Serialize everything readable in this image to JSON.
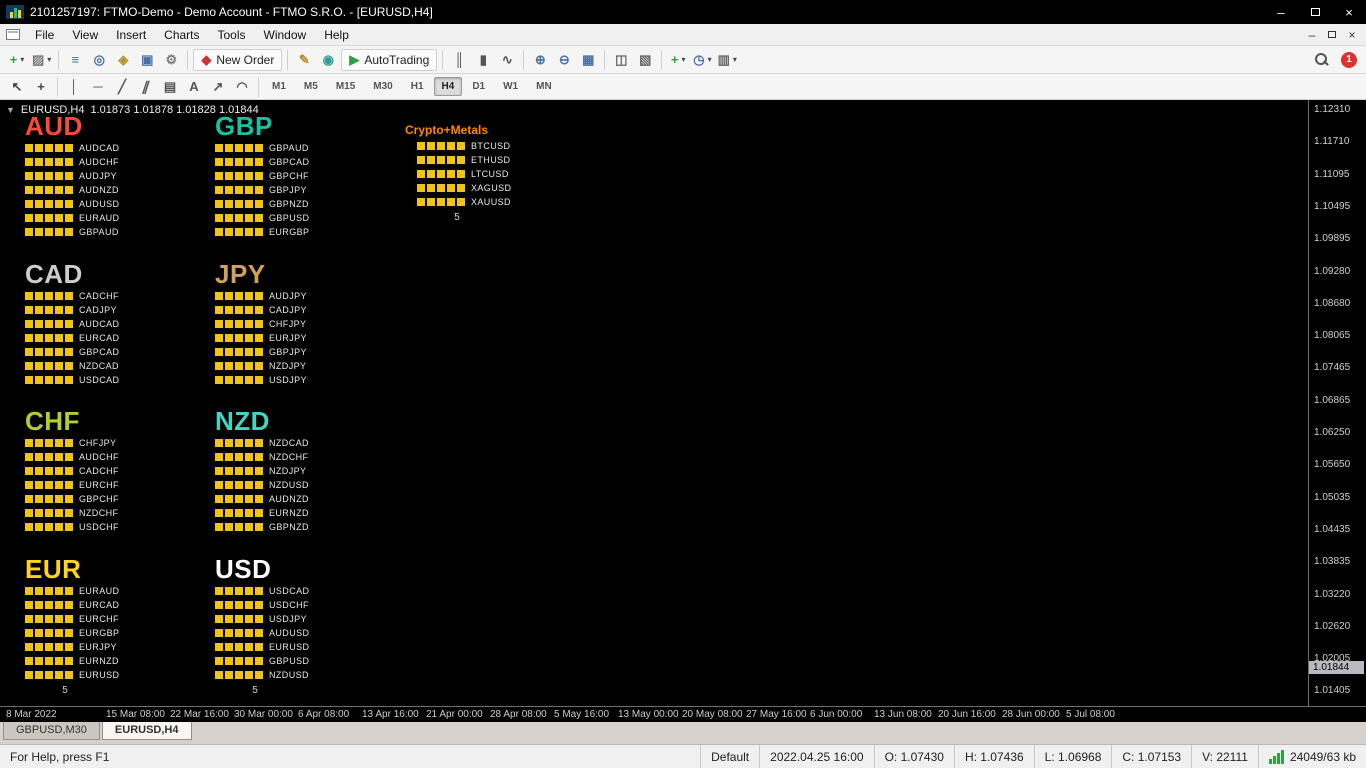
{
  "window": {
    "title": "2101257197: FTMO-Demo - Demo Account - FTMO S.R.O. - [EURUSD,H4]",
    "minimize_glyph": "–",
    "close_glyph": "×"
  },
  "menu": {
    "items": [
      "File",
      "View",
      "Insert",
      "Charts",
      "Tools",
      "Window",
      "Help"
    ]
  },
  "toolbar": {
    "main": [
      {
        "name": "new-chart-button",
        "glyph": "+",
        "color": "#2f9e44",
        "dropdown": true
      },
      {
        "name": "profiles-button",
        "glyph": "▨",
        "color": "#7a7a7a",
        "dropdown": true,
        "sep_after": true
      },
      {
        "name": "market-watch-button",
        "glyph": "≡",
        "color": "#4a6fa5"
      },
      {
        "name": "data-window-button",
        "glyph": "◎",
        "color": "#4a6fa5"
      },
      {
        "name": "navigator-button",
        "glyph": "◈",
        "color": "#b8902a"
      },
      {
        "name": "terminal-button",
        "glyph": "▣",
        "color": "#4a6fa5"
      },
      {
        "name": "strategy-tester-button",
        "glyph": "⚙",
        "color": "#7a7a7a",
        "sep_after": true
      },
      {
        "name": "new-order-button",
        "glyph": "◆",
        "color": "#cc3333",
        "label": "New Order",
        "labeled": true,
        "sep_after": true
      },
      {
        "name": "metaeditor-button",
        "glyph": "✎",
        "color": "#b8902a"
      },
      {
        "name": "mql5-button",
        "glyph": "◉",
        "color": "#2a9d8f"
      },
      {
        "name": "autotrading-button",
        "glyph": "▶",
        "color": "#2f9e44",
        "label": "AutoTrading",
        "labeled": true,
        "sep_after": true
      },
      {
        "name": "chart-bars-button",
        "glyph": "║",
        "color": "#555555"
      },
      {
        "name": "chart-candles-button",
        "glyph": "▮",
        "color": "#555555"
      },
      {
        "name": "chart-line-button",
        "glyph": "∿",
        "color": "#555555",
        "sep_after": true
      },
      {
        "name": "zoom-in-button",
        "glyph": "⊕",
        "color": "#4a6fa5"
      },
      {
        "name": "zoom-out-button",
        "glyph": "⊖",
        "color": "#4a6fa5"
      },
      {
        "name": "tile-windows-button",
        "glyph": "▦",
        "color": "#4a6fa5",
        "sep_after": true
      },
      {
        "name": "arrange-windows-button",
        "glyph": "◫",
        "color": "#666666"
      },
      {
        "name": "cascade-windows-button",
        "glyph": "▧",
        "color": "#666666",
        "sep_after": true
      },
      {
        "name": "indicators-button",
        "glyph": "+",
        "color": "#2f9e44",
        "dropdown": true
      },
      {
        "name": "periods-button",
        "glyph": "◷",
        "color": "#4a6fa5",
        "dropdown": true
      },
      {
        "name": "templates-button",
        "glyph": "▥",
        "color": "#666666",
        "dropdown": true
      }
    ],
    "drawing": [
      {
        "name": "cursor-button",
        "glyph": "↖",
        "color": "#444444"
      },
      {
        "name": "crosshair-button",
        "glyph": "+",
        "color": "#444444",
        "sep_after": true
      },
      {
        "name": "vertical-line-button",
        "glyph": "│",
        "color": "#555555"
      },
      {
        "name": "horizontal-line-button",
        "glyph": "─",
        "color": "#555555"
      },
      {
        "name": "trendline-button",
        "glyph": "╱",
        "color": "#555555"
      },
      {
        "name": "channel-button",
        "glyph": "∥",
        "color": "#555555",
        "skew": true
      },
      {
        "name": "fibonacci-button",
        "glyph": "▤",
        "color": "#555555"
      },
      {
        "name": "text-button",
        "glyph": "A",
        "color": "#555555"
      },
      {
        "name": "arrows-button",
        "glyph": "↗",
        "color": "#555555"
      },
      {
        "name": "cycle-lines-button",
        "glyph": "◠",
        "color": "#555555",
        "sep_after": true
      }
    ],
    "timeframes": [
      {
        "label": "M1"
      },
      {
        "label": "M5"
      },
      {
        "label": "M15"
      },
      {
        "label": "M30"
      },
      {
        "label": "H1"
      },
      {
        "label": "H4",
        "active": true
      },
      {
        "label": "D1"
      },
      {
        "label": "W1"
      },
      {
        "label": "MN"
      }
    ],
    "notification_count": "1"
  },
  "chart": {
    "header_symbol": "EURUSD,H4",
    "header_ohlc": "1.01873 1.01878 1.01828 1.01844",
    "one_click_arrow": "▼",
    "panels": [
      {
        "id": "aud",
        "title": "AUD",
        "color": "#ff4a3a",
        "col": 1,
        "row": 1,
        "pairs": [
          "AUDCAD",
          "AUDCHF",
          "AUDJPY",
          "AUDNZD",
          "AUDUSD",
          "EURAUD",
          "GBPAUD"
        ]
      },
      {
        "id": "gbp",
        "title": "GBP",
        "color": "#17c3a2",
        "col": 2,
        "row": 1,
        "pairs": [
          "GBPAUD",
          "GBPCAD",
          "GBPCHF",
          "GBPJPY",
          "GBPNZD",
          "GBPUSD",
          "EURGBP"
        ]
      },
      {
        "id": "crypto",
        "title": "Crypto+Metals",
        "color": "#ff8a00",
        "col": 3,
        "row": 1,
        "small": true,
        "counter": "5",
        "pairs": [
          "BTCUSD",
          "ETHUSD",
          "LTCUSD",
          "XAGUSD",
          "XAUUSD"
        ]
      },
      {
        "id": "cad",
        "title": "CAD",
        "color": "#cccccc",
        "col": 1,
        "row": 2,
        "pairs": [
          "CADCHF",
          "CADJPY",
          "AUDCAD",
          "EURCAD",
          "GBPCAD",
          "NZDCAD",
          "USDCAD"
        ]
      },
      {
        "id": "jpy",
        "title": "JPY",
        "color": "#d2a159",
        "col": 2,
        "row": 2,
        "pairs": [
          "AUDJPY",
          "CADJPY",
          "CHFJPY",
          "EURJPY",
          "GBPJPY",
          "NZDJPY",
          "USDJPY"
        ]
      },
      {
        "id": "chf",
        "title": "CHF",
        "color": "#b4cc2e",
        "col": 1,
        "row": 3,
        "pairs": [
          "CHFJPY",
          "AUDCHF",
          "CADCHF",
          "EURCHF",
          "GBPCHF",
          "NZDCHF",
          "USDCHF"
        ]
      },
      {
        "id": "nzd",
        "title": "NZD",
        "color": "#3fd6c4",
        "col": 2,
        "row": 3,
        "pairs": [
          "NZDCAD",
          "NZDCHF",
          "NZDJPY",
          "NZDUSD",
          "AUDNZD",
          "EURNZD",
          "GBPNZD"
        ]
      },
      {
        "id": "eur",
        "title": "EUR",
        "color": "#ffd41e",
        "col": 1,
        "row": 4,
        "counter": "5",
        "pairs": [
          "EURAUD",
          "EURCAD",
          "EURCHF",
          "EURGBP",
          "EURJPY",
          "EURNZD",
          "EURUSD"
        ]
      },
      {
        "id": "usd",
        "title": "USD",
        "color": "#ffffff",
        "col": 2,
        "row": 4,
        "counter": "5",
        "pairs": [
          "USDCAD",
          "USDCHF",
          "USDJPY",
          "AUDUSD",
          "EURUSD",
          "GBPUSD",
          "NZDUSD"
        ]
      }
    ],
    "price_scale": [
      "1.12310",
      "1.11710",
      "1.11095",
      "1.10495",
      "1.09895",
      "1.09280",
      "1.08680",
      "1.08065",
      "1.07465",
      "1.06865",
      "1.06250",
      "1.05650",
      "1.05035",
      "1.04435",
      "1.03835",
      "1.03220",
      "1.02620",
      "1.02005",
      "1.01405"
    ],
    "current_price": "1.01844",
    "time_axis": [
      "8 Mar 2022",
      "15 Mar 08:00",
      "22 Mar 16:00",
      "30 Mar 00:00",
      "6 Apr 08:00",
      "13 Apr 16:00",
      "21 Apr 00:00",
      "28 Apr 08:00",
      "5 May 16:00",
      "13 May 00:00",
      "20 May 08:00",
      "27 May 16:00",
      "6 Jun 00:00",
      "13 Jun 08:00",
      "20 Jun 16:00",
      "28 Jun 00:00",
      "5 Jul 08:00"
    ]
  },
  "tabs": [
    {
      "label": "GBPUSD,M30"
    },
    {
      "label": "EURUSD,H4",
      "active": true
    }
  ],
  "status": {
    "help": "For Help, press F1",
    "profile": "Default",
    "datetime": "2022.04.25 16:00",
    "ohlcv": [
      "O: 1.07430",
      "H: 1.07436",
      "L: 1.06968",
      "C: 1.07153",
      "V: 22111"
    ],
    "connection": "24049/63 kb"
  }
}
